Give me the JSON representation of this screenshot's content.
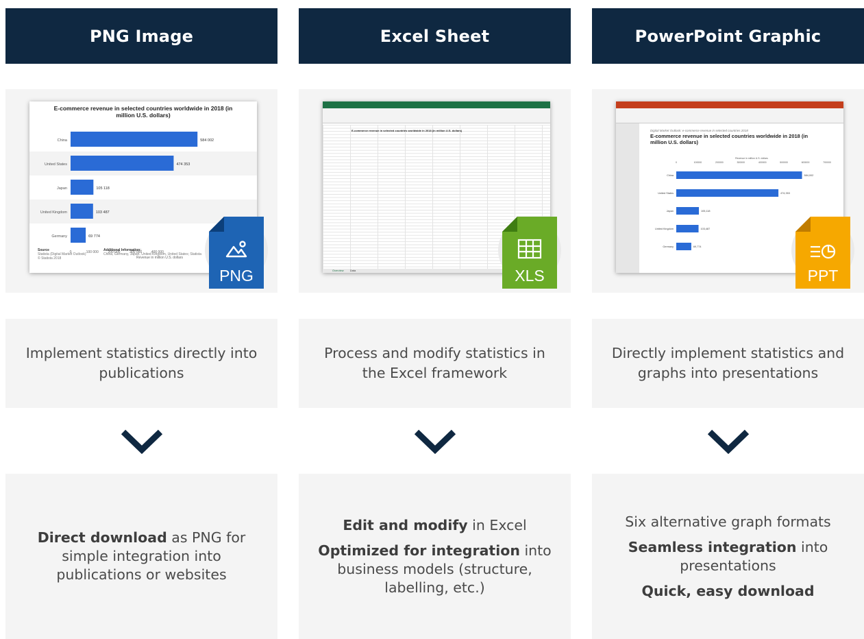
{
  "columns": [
    {
      "title": "PNG Image",
      "description": "Implement statistics directly into publications",
      "badge": "PNG",
      "icon_color": "#1e64b4",
      "features": [
        {
          "bold": "Direct download",
          "rest": " as PNG for simple integration into publications or websites"
        }
      ]
    },
    {
      "title": "Excel Sheet",
      "description": "Process and modify statistics in the Excel framework",
      "badge": "XLS",
      "icon_color": "#6aab27",
      "features": [
        {
          "bold": "Edit and modify",
          "rest": " in Excel"
        },
        {
          "bold": "Optimized for integration",
          "rest": " into business models (structure, labelling, etc.)"
        }
      ]
    },
    {
      "title": "PowerPoint Graphic",
      "description": "Directly implement statistics and graphs into presentations",
      "badge": "PPT",
      "icon_color": "#f6a800",
      "features": [
        {
          "bold": "",
          "rest": "Six alternative graph formats"
        },
        {
          "bold": "Seamless integration",
          "rest": " into presentations"
        },
        {
          "bold": "Quick, easy download",
          "rest": ""
        }
      ]
    }
  ],
  "colors": {
    "header_bg": "#0f2841",
    "panel_bg": "#f4f4f4",
    "bar_blue": "#2a6bd6",
    "arrow": "#0f2841"
  },
  "png_preview": {
    "title": "E-commerce revenue in selected countries worldwide in 2018 (in million U.S. dollars)",
    "xlabel": "Revenue in million U.S. dollars",
    "source_label": "Source",
    "source_text": "Statista (Digital Market Outlook)",
    "copyright": "© Statista 2018",
    "info_label": "Additional Information:",
    "info_text": "China, Germany, Japan, United Kingdom, United States; Statista",
    "chart_data": {
      "type": "bar",
      "orientation": "horizontal",
      "categories": [
        "China",
        "United States",
        "Japan",
        "United Kingdom",
        "Germany"
      ],
      "values": [
        584002,
        474353,
        105118,
        103487,
        69774
      ],
      "value_labels": [
        "584 002",
        "474 353",
        "105 118",
        "103 487",
        "69 774"
      ],
      "xticks": [
        "0",
        "100 000",
        "200 000",
        "300 000",
        "400 000"
      ],
      "xlim": [
        0,
        700000
      ]
    }
  },
  "xls_preview": {
    "title": "E-commerce revenue in selected countries worldwide in 2018 (in million U.S. dollars)",
    "sheet_tabs": [
      "Overview",
      "Data"
    ]
  },
  "ppt_preview": {
    "subtitle": "Digital Market Outlook: e-commerce revenue in selected countries 2018",
    "title": "E-commerce revenue in selected countries worldwide in 2018 (in million U.S. dollars)",
    "axis_title": "Revenue in million U.S. dollars",
    "chart_data": {
      "type": "bar",
      "orientation": "horizontal",
      "categories": [
        "China",
        "United States",
        "Japan",
        "United Kingdom",
        "Germany"
      ],
      "values": [
        584002,
        474353,
        105118,
        103487,
        69774
      ],
      "value_labels": [
        "584,002",
        "474,353",
        "105,118",
        "103,487",
        "69,774"
      ],
      "xticks": [
        "0",
        "100000",
        "200000",
        "300000",
        "400000",
        "500000",
        "600000",
        "700000"
      ],
      "xlim": [
        0,
        700000
      ]
    }
  }
}
